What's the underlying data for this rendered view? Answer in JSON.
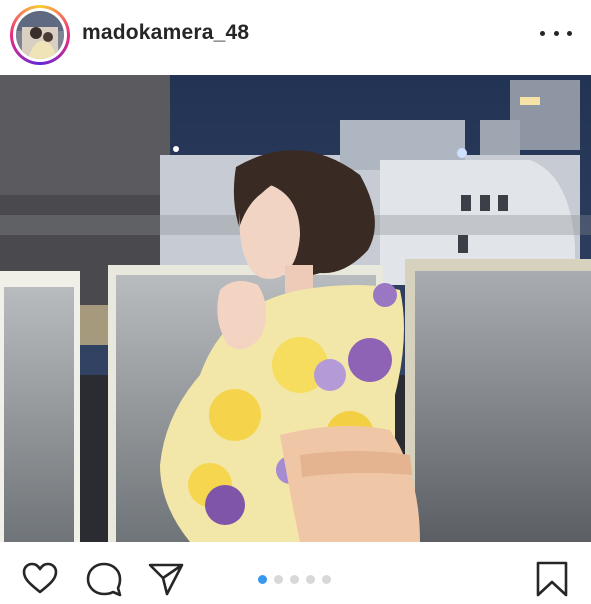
{
  "post": {
    "username": "madokamera_48",
    "more_icon": "more-horizontal-icon",
    "carousel": {
      "count": 5,
      "active_index": 0
    },
    "colors": {
      "accent": "#3897f0",
      "text": "#262626",
      "dot_inactive": "#d8d8d8"
    },
    "actions": {
      "like_icon": "heart-outline-icon",
      "comment_icon": "comment-bubble-icon",
      "share_icon": "paper-plane-icon",
      "save_icon": "bookmark-outline-icon"
    }
  }
}
